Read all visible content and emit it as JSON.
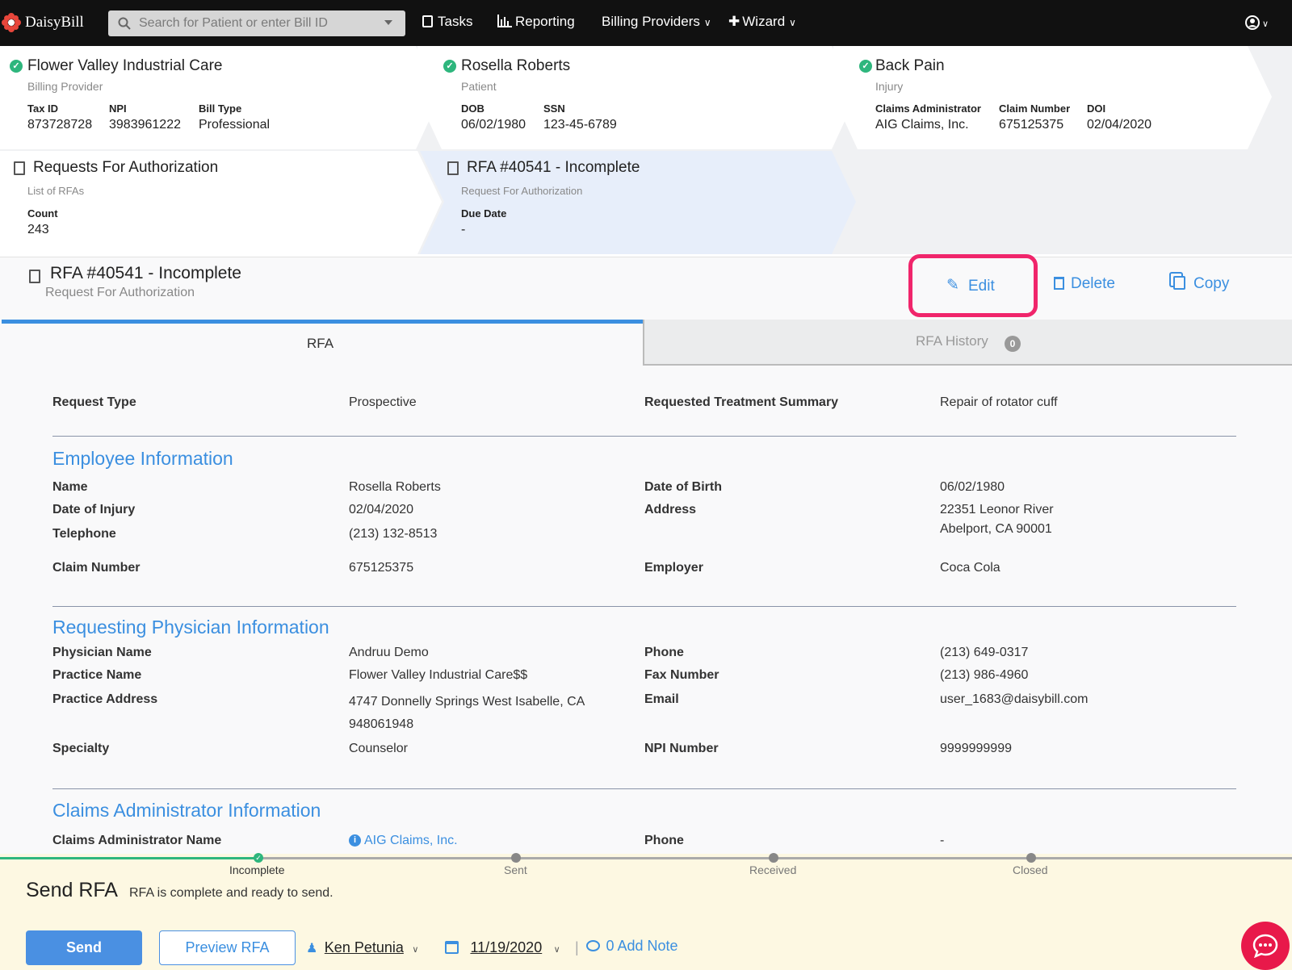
{
  "topnav": {
    "brand": "DaisyBill",
    "search_placeholder": "Search for Patient or enter Bill ID",
    "tasks": "Tasks",
    "reporting": "Reporting",
    "billing_providers": "Billing Providers",
    "wizard": "Wizard"
  },
  "cards": {
    "provider": {
      "title": "Flower Valley Industrial Care",
      "subtitle": "Billing Provider",
      "tax_id_label": "Tax ID",
      "tax_id": "873728728",
      "npi_label": "NPI",
      "npi": "3983961222",
      "bill_type_label": "Bill Type",
      "bill_type": "Professional"
    },
    "patient": {
      "title": "Rosella Roberts",
      "subtitle": "Patient",
      "dob_label": "DOB",
      "dob": "06/02/1980",
      "ssn_label": "SSN",
      "ssn": "123-45-6789"
    },
    "injury": {
      "title": "Back Pain",
      "subtitle": "Injury",
      "ca_label": "Claims Administrator",
      "ca": "AIG Claims, Inc.",
      "claim_label": "Claim Number",
      "claim": "675125375",
      "doi_label": "DOI",
      "doi": "02/04/2020"
    },
    "rfas": {
      "title": "Requests For Authorization",
      "subtitle": "List of RFAs",
      "count_label": "Count",
      "count": "243"
    },
    "rfa": {
      "title": "RFA #40541 - Incomplete",
      "subtitle": "Request For Authorization",
      "due_label": "Due Date",
      "due": "-"
    }
  },
  "header": {
    "title": "RFA #40541 - Incomplete",
    "subtitle": "Request For Authorization",
    "edit": "Edit",
    "delete": "Delete",
    "copy": "Copy"
  },
  "tabs": {
    "rfa": "RFA",
    "history": "RFA History",
    "history_count": "0"
  },
  "request": {
    "type_label": "Request Type",
    "type": "Prospective",
    "summary_label": "Requested Treatment Summary",
    "summary": "Repair of rotator cuff"
  },
  "employee": {
    "heading": "Employee Information",
    "name_label": "Name",
    "name": "Rosella Roberts",
    "doi_label": "Date of Injury",
    "doi": "02/04/2020",
    "phone_label": "Telephone",
    "phone": "(213) 132-8513",
    "claim_label": "Claim Number",
    "claim": "675125375",
    "dob_label": "Date of Birth",
    "dob": "06/02/1980",
    "address_label": "Address",
    "address_line1": "22351 Leonor River",
    "address_line2": "Abelport, CA 90001",
    "employer_label": "Employer",
    "employer": "Coca Cola"
  },
  "physician": {
    "heading": "Requesting Physician Information",
    "name_label": "Physician Name",
    "name": "Andruu Demo",
    "practice_label": "Practice Name",
    "practice": "Flower Valley Industrial Care$$",
    "address_label": "Practice Address",
    "address_line1": "4747 Donnelly Springs West Isabelle, CA",
    "address_line2": "948061948",
    "specialty_label": "Specialty",
    "specialty": "Counselor",
    "phone_label": "Phone",
    "phone": "(213) 649-0317",
    "fax_label": "Fax Number",
    "fax": "(213) 986-4960",
    "email_label": "Email",
    "email": "user_1683@daisybill.com",
    "npi_label": "NPI Number",
    "npi": "9999999999"
  },
  "claims_admin": {
    "heading": "Claims Administrator Information",
    "name_label": "Claims Administrator Name",
    "name": "AIG Claims, Inc.",
    "phone_label": "Phone",
    "phone": "-"
  },
  "progress": {
    "steps": [
      "Incomplete",
      "Sent",
      "Received",
      "Closed"
    ],
    "current": "Incomplete"
  },
  "footer": {
    "title": "Send RFA",
    "message": "RFA is complete and ready to send.",
    "send": "Send",
    "preview": "Preview RFA",
    "user": "Ken Petunia",
    "date": "11/19/2020",
    "note": "0 Add Note"
  },
  "colors": {
    "accent": "#3b8fe0",
    "highlight": "#f0256b",
    "success": "#2eb67d",
    "footer_bg": "#fdf8e2",
    "active_card_bg": "#e7eefa"
  }
}
